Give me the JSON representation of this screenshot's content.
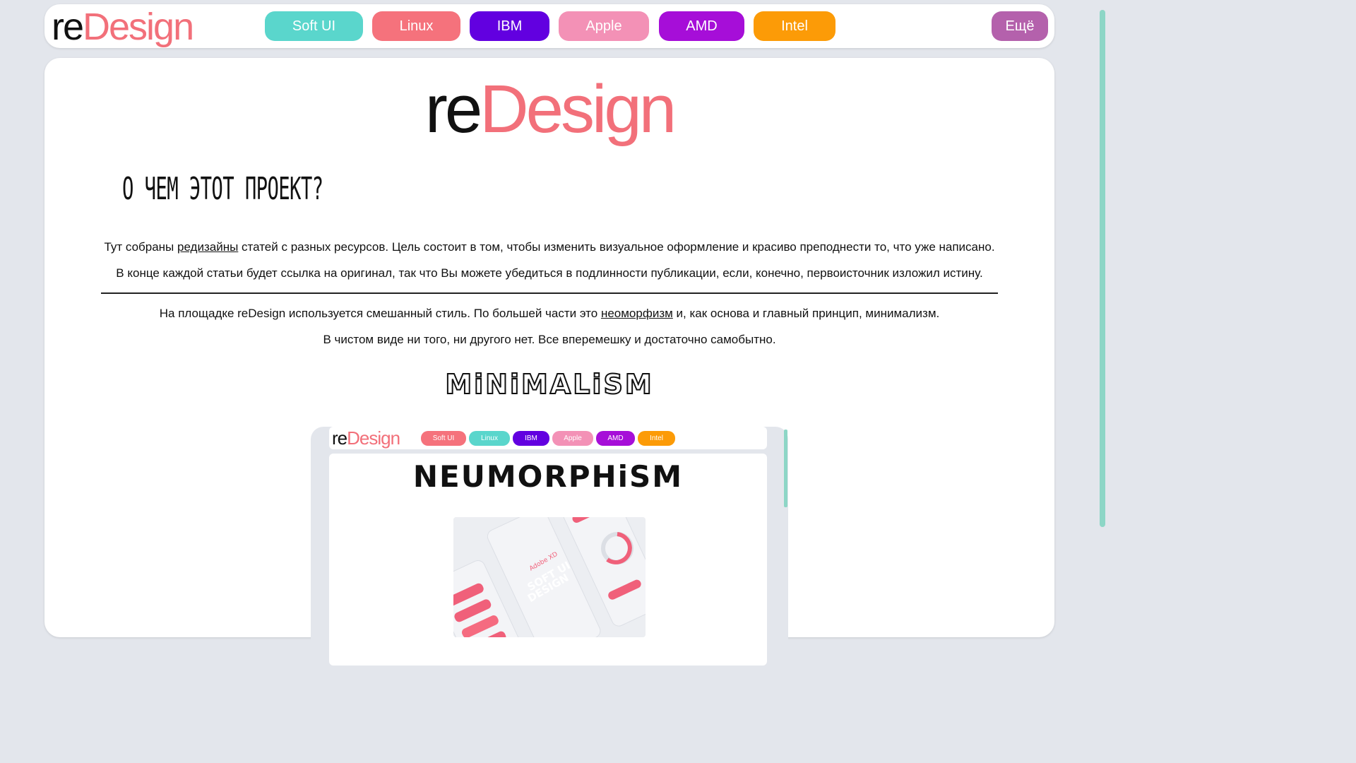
{
  "nav": {
    "logo_re": "re",
    "logo_design": "Design",
    "items": [
      {
        "label": "Soft UI",
        "color": "#5ad6cc"
      },
      {
        "label": "Linux",
        "color": "#f5727c"
      },
      {
        "label": "IBM",
        "color": "#6200e0"
      },
      {
        "label": "Apple",
        "color": "#f391b6"
      },
      {
        "label": "AMD",
        "color": "#a60ed8"
      },
      {
        "label": "Intel",
        "color": "#fc9b07"
      }
    ],
    "more": {
      "label": "Ещё",
      "color": "#b461ac"
    }
  },
  "main": {
    "hero_re": "re",
    "hero_design": "Design",
    "about_heading": "О ЧЕМ ЭТОТ ПРОЕКТ?",
    "p1_before": "Тут собраны ",
    "p1_link": "редизайны",
    "p1_after": " статей с разных ресурсов. Цель состоит в том, чтобы изменить визуальное оформление и красиво преподнести то, что уже написано.",
    "p2": "В конце каждой статьи будет ссылка на оригинал, так что Вы можете убедиться в подлинности публикации, если, конечно, первоисточник изложил истину.",
    "p3_before": "На площадке reDesign используется смешанный стиль. По большей части это ",
    "p3_link": "неоморфизм",
    "p3_after": " и, как основа и главный принцип, минимализм.",
    "p4": "В чистом виде ни того, ни другого нет. Все вперемешку и достаточно самобытно.",
    "minimalism_heading": "MiNiMALiSM"
  },
  "preview": {
    "logo_re": "re",
    "logo_design": "Design",
    "items": [
      {
        "label": "Soft UI",
        "color": "#f5727c"
      },
      {
        "label": "Linux",
        "color": "#5ad6cc"
      },
      {
        "label": "IBM",
        "color": "#6200e0"
      },
      {
        "label": "Apple",
        "color": "#f391b6"
      },
      {
        "label": "AMD",
        "color": "#a60ed8"
      },
      {
        "label": "Intel",
        "color": "#fc9b07"
      }
    ],
    "title": "NEUMORPHiSM",
    "image_caption_1": "Adobe XD",
    "image_caption_2": "SOFT UI",
    "image_caption_3": "DESIGN"
  }
}
